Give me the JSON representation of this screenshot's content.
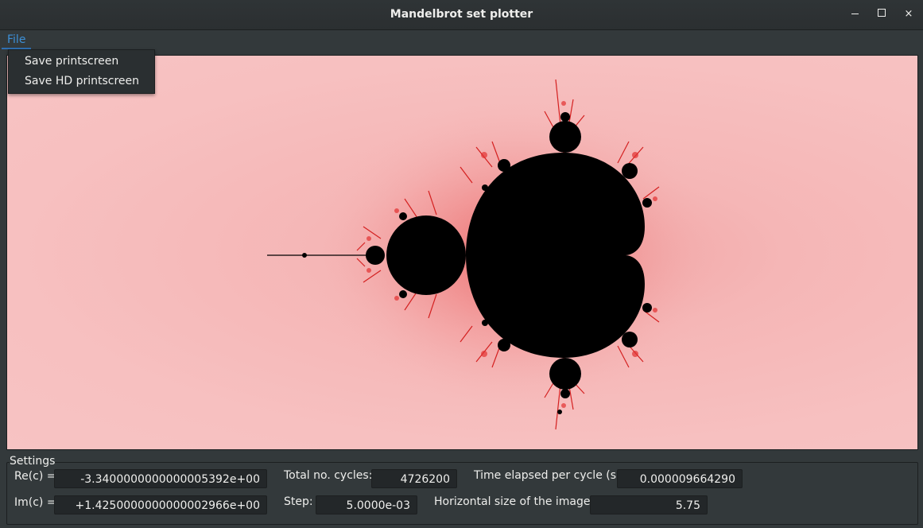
{
  "window": {
    "title": "Mandelbrot set plotter",
    "controls": {
      "minimize": "minimize-icon",
      "maximize": "maximize-icon",
      "close": "×"
    }
  },
  "menubar": {
    "file_label": "File"
  },
  "file_menu": {
    "items": [
      "Save printscreen",
      "Save HD printscreen"
    ]
  },
  "plot": {
    "background_color": "#f5b6b6",
    "set_color": "#000000",
    "fringe_color": "#e02020"
  },
  "settings": {
    "legend": "Settings",
    "re_label": "Re(c) =",
    "re_value": "-3.3400000000000005392e+00",
    "im_label": "Im(c) =",
    "im_value": "+1.4250000000000002966e+00",
    "cycles_label": "Total no. cycles:",
    "cycles_value": "4726200",
    "step_label": "Step:",
    "step_value": "5.0000e-03",
    "time_label": "Time elapsed per cycle (s):",
    "time_value": "0.000009664290",
    "hsize_label": "Horizontal size of the image:",
    "hsize_value": "5.75"
  }
}
